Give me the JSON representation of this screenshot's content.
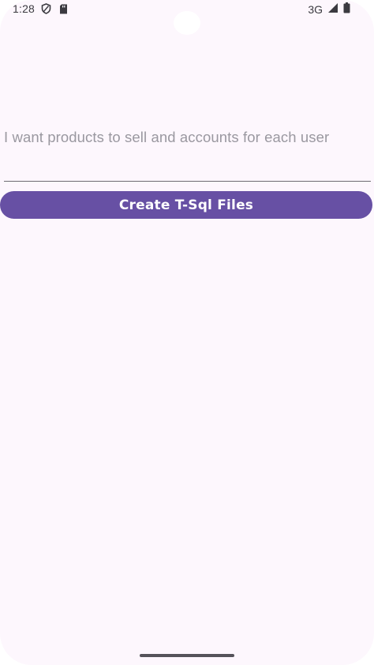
{
  "status_bar": {
    "time": "1:28",
    "network": "3G"
  },
  "prompt": {
    "placeholder": "I want products to sell and accounts for each user"
  },
  "actions": {
    "create_label": "Create T-Sql Files"
  },
  "colors": {
    "surface": "#fdf7fd",
    "primary": "#6750a4",
    "placeholder_text": "#9a98a0",
    "underline": "#6d6b72"
  },
  "icons": {
    "status_left": [
      "shield-icon",
      "sd-card-icon"
    ],
    "status_right": [
      "signal-icon",
      "battery-icon"
    ]
  }
}
